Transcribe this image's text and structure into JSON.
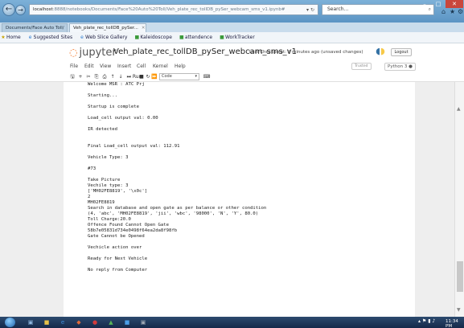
{
  "browser": {
    "address": {
      "host": "localhost",
      "path": ":8888/notebooks/Documents/Face%20Auto%20Toll/Veh_plate_rec_tollDB_pySer_webcam_sms_v1.ipynb#"
    },
    "search_placeholder": "Search...",
    "tabs": [
      {
        "label": "Documents/Face Auto Toll/"
      },
      {
        "label": "Veh_plate_rec_tollDB_pySer..."
      }
    ],
    "favorites": [
      {
        "label": "Home",
        "icon": "home-icon"
      },
      {
        "label": "Suggested Sites",
        "icon": "favorite-icon"
      },
      {
        "label": "Web Slice Gallery",
        "icon": "ie-icon"
      },
      {
        "label": "Kaleidoscope",
        "icon": "app-icon"
      },
      {
        "label": "attendence",
        "icon": "app-icon"
      },
      {
        "label": "WorkTracker",
        "icon": "app-icon"
      }
    ]
  },
  "jupyter": {
    "logo_text": "jupyter",
    "notebook_title": "Veh_plate_rec_tollDB_pySer_webcam_sms_v1",
    "checkpoint": "Last Checkpoint: 2 minutes ago",
    "unsaved": "(unsaved changes)",
    "logout_label": "Logout",
    "menus": [
      "File",
      "Edit",
      "View",
      "Insert",
      "Cell",
      "Kernel",
      "Help"
    ],
    "trusted_label": "Trusted",
    "kernel_label": "Python 3",
    "toolbar": {
      "run_label": "Run",
      "cell_type": "Code"
    }
  },
  "output_lines": [
    "Welcome MSR : ATC Prj",
    "",
    "Starting...",
    "",
    "Startup is complete",
    "",
    "Load_cell output val: 0.00",
    "",
    "IR detected",
    "",
    "",
    "Final Load_cell output val: 112.91",
    "",
    "Vehicle Type: 3",
    "",
    "#73",
    "",
    "Take Picture",
    "Vechile type: 3",
    "['MH02FE8819', '\\x0c']",
    "2",
    "MH02FE8819",
    "Search in database and open gate as per balance or other condition",
    "(4, 'abc', 'MH02FE8819', 'jii', 'wbc', '98000', 'N', 'Y', 80.0)",
    "Toll Charge:20.0",
    "Offence Found Cannot Open Gate",
    "58b7e05831d734e0498f64ea2da8f98fb",
    "Gate Cannot be Opened",
    "",
    "Vechicle action over",
    "",
    "Ready for Next Vehicle",
    "",
    "No reply from Computer"
  ],
  "taskbar": {
    "clock": "11:34 PM"
  },
  "colors": {
    "jupyter_orange": "#f37626",
    "browser_chrome": "#5b94c4",
    "taskbar": "#15294a"
  }
}
